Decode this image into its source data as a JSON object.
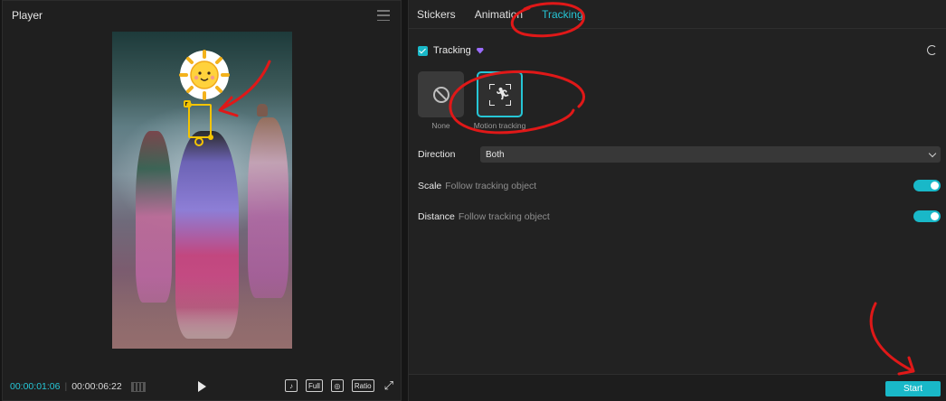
{
  "player": {
    "title": "Player",
    "time_current": "00:00:01:06",
    "time_total": "00:00:06:22",
    "tools": {
      "full": "Full",
      "ratio": "Ratio"
    },
    "sticker_icon": "sun-sticker"
  },
  "panel": {
    "tabs": [
      "Stickers",
      "Animation",
      "Tracking"
    ],
    "active_tab": "Tracking",
    "tracking_label": "Tracking",
    "options": [
      {
        "label": "None",
        "icon": "none-icon"
      },
      {
        "label": "Motion tracking",
        "icon": "motion-tracking-icon"
      }
    ],
    "direction": {
      "label": "Direction",
      "value": "Both"
    },
    "scale": {
      "label": "Scale",
      "hint": "Follow tracking object",
      "enabled": true
    },
    "distance": {
      "label": "Distance",
      "hint": "Follow tracking object",
      "enabled": true
    },
    "start_label": "Start"
  },
  "colors": {
    "accent": "#19b8c8",
    "annotation": "#e01818",
    "premium": "#9b6cff"
  }
}
